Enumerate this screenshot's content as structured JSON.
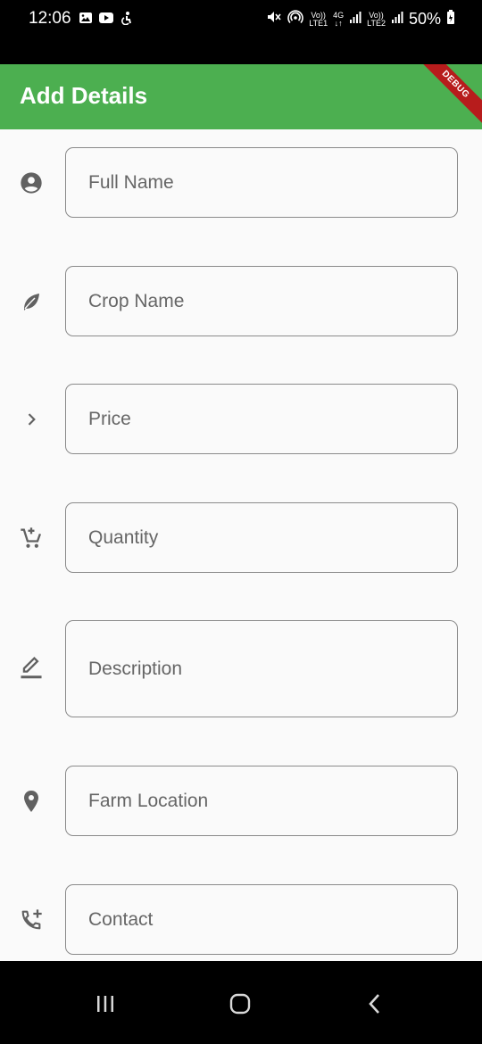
{
  "status_bar": {
    "time": "12:06",
    "left_icons": [
      "image-icon",
      "youtube-icon",
      "accessibility-icon"
    ],
    "right_icons": [
      "mute-icon",
      "hotspot-icon",
      "volte1-icon",
      "4g-icon",
      "signal1-icon",
      "volte2-icon",
      "signal2-icon"
    ],
    "volte1_top": "Vo))",
    "volte1_bottom": "LTE1",
    "net_top": "4G",
    "net_bottom": "↓↑",
    "volte2_top": "Vo))",
    "volte2_bottom": "LTE2",
    "battery": "50%"
  },
  "app_bar": {
    "title": "Add Details",
    "debug_label": "DEBUG",
    "color": "#4caf50"
  },
  "form": {
    "fields": [
      {
        "icon": "account-circle-icon",
        "placeholder": "Full Name"
      },
      {
        "icon": "leaf-icon",
        "placeholder": "Crop Name"
      },
      {
        "icon": "chevron-right-icon",
        "placeholder": "Price"
      },
      {
        "icon": "add-shopping-cart-icon",
        "placeholder": "Quantity"
      },
      {
        "icon": "edit-icon",
        "placeholder": "Description"
      },
      {
        "icon": "location-pin-icon",
        "placeholder": "Farm Location"
      },
      {
        "icon": "add-call-icon",
        "placeholder": "Contact"
      }
    ]
  },
  "nav_bar": {
    "buttons": [
      "recents-icon",
      "home-icon",
      "back-icon"
    ]
  }
}
